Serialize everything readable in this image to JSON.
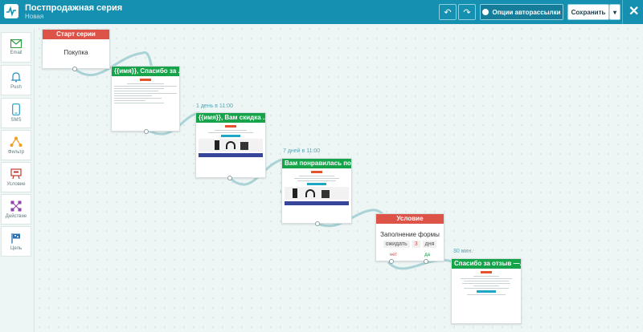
{
  "topbar": {
    "title": "Постпродажная серия",
    "subtitle": "Новая",
    "undo_label": "↶",
    "redo_label": "↷",
    "options_label": "Опции авторассылки",
    "save_label": "Сохранить",
    "save_dropdown_label": "▾",
    "close_label": "✕"
  },
  "sidebar": {
    "items": [
      {
        "label": "Email",
        "icon": "email-icon"
      },
      {
        "label": "Push",
        "icon": "bell-icon"
      },
      {
        "label": "SMS",
        "icon": "phone-icon"
      },
      {
        "label": "Фильтр",
        "icon": "filter-icon"
      },
      {
        "label": "Условие",
        "icon": "condition-icon"
      },
      {
        "label": "Действие",
        "icon": "action-icon"
      },
      {
        "label": "Цель",
        "icon": "flag-icon"
      }
    ]
  },
  "nodes": {
    "start": {
      "title": "Старт серии",
      "text": "Покупка"
    },
    "email1": {
      "title": "{{имя}}, Спасибо за ..."
    },
    "email2": {
      "title": "{{имя}}, Вам скидка ...",
      "timer": "1 день в 11:00"
    },
    "email3": {
      "title": "Вам понравилась по...",
      "timer": "7 дней в 11:00"
    },
    "condition": {
      "title": "Условие",
      "text": "Заполнение формы",
      "wait_label": "ожидать",
      "wait_value": "3",
      "wait_unit": "дня",
      "no_label": "нет",
      "yes_label": "да"
    },
    "email4": {
      "title": "Спасибо за отзыв —...",
      "timer": "30 мин."
    }
  },
  "colors": {
    "accent": "#1690b0",
    "green_header": "#16a34a",
    "red_header": "#de5347",
    "link": "#a9d3d6"
  }
}
